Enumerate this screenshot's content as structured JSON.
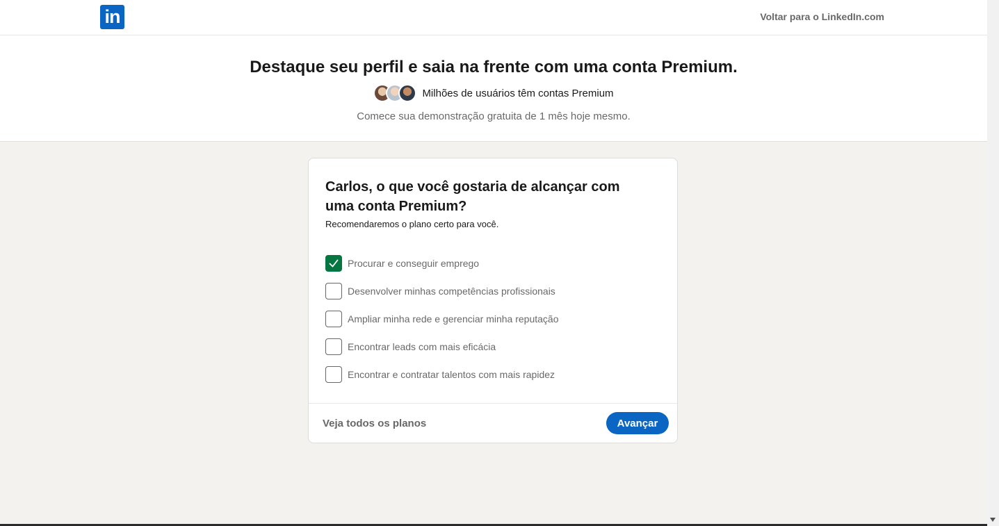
{
  "header": {
    "logo_text": "in",
    "back_link": "Voltar para o LinkedIn.com"
  },
  "hero": {
    "title": "Destaque seu perfil e saia na frente com uma conta Premium.",
    "social_proof": "Milhões de usuários têm contas Premium",
    "subtitle": "Comece sua demonstração gratuita de 1 mês hoje mesmo."
  },
  "card": {
    "title": "Carlos, o que você gostaria de alcançar com uma conta Premium?",
    "subtitle": "Recomendaremos o plano certo para você.",
    "options": [
      {
        "label": "Procurar e conseguir emprego",
        "checked": true
      },
      {
        "label": "Desenvolver minhas competências profissionais",
        "checked": false
      },
      {
        "label": "Ampliar minha rede e gerenciar minha reputação",
        "checked": false
      },
      {
        "label": "Encontrar leads com mais eficácia",
        "checked": false
      },
      {
        "label": "Encontrar e contratar talentos com mais rapidez",
        "checked": false
      }
    ],
    "see_all_plans": "Veja todos os planos",
    "next_button": "Avançar"
  },
  "colors": {
    "brand": "#0a66c2",
    "checked": "#057642",
    "page_bg": "#f3f2ef"
  }
}
